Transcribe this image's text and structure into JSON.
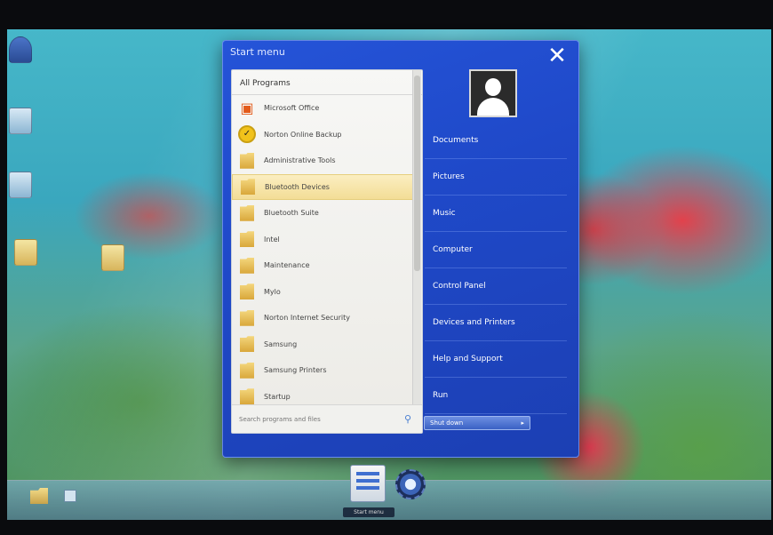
{
  "start_menu": {
    "title": "Start menu",
    "close_glyph": "✕",
    "programs_header": "All Programs",
    "programs": [
      {
        "label": "Microsoft Office",
        "icon": "office-icon",
        "selected": false
      },
      {
        "label": "Norton Online Backup",
        "icon": "norton-icon",
        "selected": false
      },
      {
        "label": "Administrative Tools",
        "icon": "folder-icon",
        "selected": false
      },
      {
        "label": "Bluetooth Devices",
        "icon": "folder-icon",
        "selected": true
      },
      {
        "label": "Bluetooth Suite",
        "icon": "folder-icon",
        "selected": false
      },
      {
        "label": "Intel",
        "icon": "folder-icon",
        "selected": false
      },
      {
        "label": "Maintenance",
        "icon": "folder-icon",
        "selected": false
      },
      {
        "label": "Mylo",
        "icon": "folder-icon",
        "selected": false
      },
      {
        "label": "Norton Internet Security",
        "icon": "folder-icon",
        "selected": false
      },
      {
        "label": "Samsung",
        "icon": "folder-icon",
        "selected": false
      },
      {
        "label": "Samsung Printers",
        "icon": "folder-icon",
        "selected": false
      },
      {
        "label": "Startup",
        "icon": "folder-icon",
        "selected": false
      }
    ],
    "search_placeholder": "Search programs and files",
    "links": [
      "Documents",
      "Pictures",
      "Music",
      "Computer",
      "Control Panel",
      "Devices and Printers",
      "Help and Support",
      "Run"
    ],
    "shutdown_label": "Shut down",
    "shutdown_arrow": "▸"
  },
  "taskbar": {
    "start_tooltip": "Start menu"
  },
  "colors": {
    "start_panel": "#2252d4",
    "selected_item": "#f3dd96",
    "programs_bg": "#f4f4f1"
  }
}
